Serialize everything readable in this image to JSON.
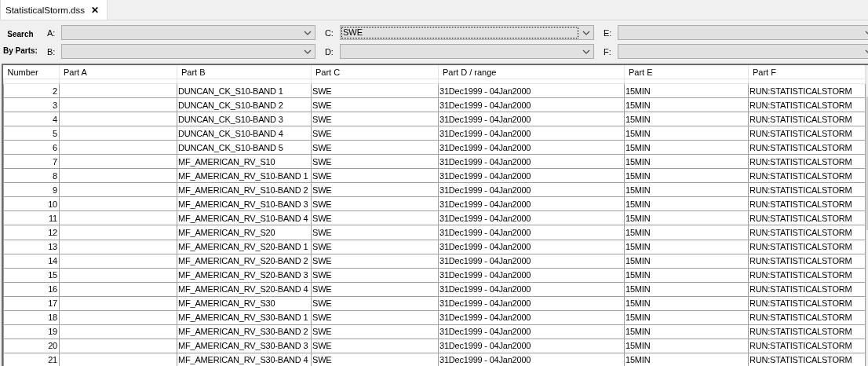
{
  "tabs": [
    {
      "label": "StatisticalStorm.dss",
      "selected": true,
      "close": "✕"
    }
  ],
  "search": {
    "title_lines": [
      "Search",
      "By Parts:"
    ],
    "fields": [
      {
        "label": "A:",
        "focused": false
      },
      {
        "label": "B:",
        "focused": false
      },
      {
        "label": "C:",
        "value": "SWE",
        "focused": true
      },
      {
        "label": "D:",
        "focused": false
      },
      {
        "label": "E:",
        "focused": false
      },
      {
        "label": "F:",
        "focused": false
      }
    ]
  },
  "table": {
    "columns": [
      "Number",
      "Part A",
      "Part B",
      "Part C",
      "Part D / range",
      "Part E",
      "Part F"
    ],
    "rows": [
      {
        "number": "2",
        "part_b": "DUNCAN_CK_S10-BAND 1",
        "part_c": "SWE",
        "part_d": "31Dec1999 - 04Jan2000",
        "part_e": "15MIN",
        "part_f": "RUN:STATISTICALSTORM"
      },
      {
        "number": "3",
        "part_b": "DUNCAN_CK_S10-BAND 2",
        "part_c": "SWE",
        "part_d": "31Dec1999 - 04Jan2000",
        "part_e": "15MIN",
        "part_f": "RUN:STATISTICALSTORM"
      },
      {
        "number": "4",
        "part_b": "DUNCAN_CK_S10-BAND 3",
        "part_c": "SWE",
        "part_d": "31Dec1999 - 04Jan2000",
        "part_e": "15MIN",
        "part_f": "RUN:STATISTICALSTORM"
      },
      {
        "number": "5",
        "part_b": "DUNCAN_CK_S10-BAND 4",
        "part_c": "SWE",
        "part_d": "31Dec1999 - 04Jan2000",
        "part_e": "15MIN",
        "part_f": "RUN:STATISTICALSTORM"
      },
      {
        "number": "6",
        "part_b": "DUNCAN_CK_S10-BAND 5",
        "part_c": "SWE",
        "part_d": "31Dec1999 - 04Jan2000",
        "part_e": "15MIN",
        "part_f": "RUN:STATISTICALSTORM"
      },
      {
        "number": "7",
        "part_b": "MF_AMERICAN_RV_S10",
        "part_c": "SWE",
        "part_d": "31Dec1999 - 04Jan2000",
        "part_e": "15MIN",
        "part_f": "RUN:STATISTICALSTORM"
      },
      {
        "number": "8",
        "part_b": "MF_AMERICAN_RV_S10-BAND 1",
        "part_c": "SWE",
        "part_d": "31Dec1999 - 04Jan2000",
        "part_e": "15MIN",
        "part_f": "RUN:STATISTICALSTORM"
      },
      {
        "number": "9",
        "part_b": "MF_AMERICAN_RV_S10-BAND 2",
        "part_c": "SWE",
        "part_d": "31Dec1999 - 04Jan2000",
        "part_e": "15MIN",
        "part_f": "RUN:STATISTICALSTORM"
      },
      {
        "number": "10",
        "part_b": "MF_AMERICAN_RV_S10-BAND 3",
        "part_c": "SWE",
        "part_d": "31Dec1999 - 04Jan2000",
        "part_e": "15MIN",
        "part_f": "RUN:STATISTICALSTORM"
      },
      {
        "number": "11",
        "part_b": "MF_AMERICAN_RV_S10-BAND 4",
        "part_c": "SWE",
        "part_d": "31Dec1999 - 04Jan2000",
        "part_e": "15MIN",
        "part_f": "RUN:STATISTICALSTORM"
      },
      {
        "number": "12",
        "part_b": "MF_AMERICAN_RV_S20",
        "part_c": "SWE",
        "part_d": "31Dec1999 - 04Jan2000",
        "part_e": "15MIN",
        "part_f": "RUN:STATISTICALSTORM"
      },
      {
        "number": "13",
        "part_b": "MF_AMERICAN_RV_S20-BAND 1",
        "part_c": "SWE",
        "part_d": "31Dec1999 - 04Jan2000",
        "part_e": "15MIN",
        "part_f": "RUN:STATISTICALSTORM"
      },
      {
        "number": "14",
        "part_b": "MF_AMERICAN_RV_S20-BAND 2",
        "part_c": "SWE",
        "part_d": "31Dec1999 - 04Jan2000",
        "part_e": "15MIN",
        "part_f": "RUN:STATISTICALSTORM"
      },
      {
        "number": "15",
        "part_b": "MF_AMERICAN_RV_S20-BAND 3",
        "part_c": "SWE",
        "part_d": "31Dec1999 - 04Jan2000",
        "part_e": "15MIN",
        "part_f": "RUN:STATISTICALSTORM"
      },
      {
        "number": "16",
        "part_b": "MF_AMERICAN_RV_S20-BAND 4",
        "part_c": "SWE",
        "part_d": "31Dec1999 - 04Jan2000",
        "part_e": "15MIN",
        "part_f": "RUN:STATISTICALSTORM"
      },
      {
        "number": "17",
        "part_b": "MF_AMERICAN_RV_S30",
        "part_c": "SWE",
        "part_d": "31Dec1999 - 04Jan2000",
        "part_e": "15MIN",
        "part_f": "RUN:STATISTICALSTORM"
      },
      {
        "number": "18",
        "part_b": "MF_AMERICAN_RV_S30-BAND 1",
        "part_c": "SWE",
        "part_d": "31Dec1999 - 04Jan2000",
        "part_e": "15MIN",
        "part_f": "RUN:STATISTICALSTORM"
      },
      {
        "number": "19",
        "part_b": "MF_AMERICAN_RV_S30-BAND 2",
        "part_c": "SWE",
        "part_d": "31Dec1999 - 04Jan2000",
        "part_e": "15MIN",
        "part_f": "RUN:STATISTICALSTORM"
      },
      {
        "number": "20",
        "part_b": "MF_AMERICAN_RV_S30-BAND 3",
        "part_c": "SWE",
        "part_d": "31Dec1999 - 04Jan2000",
        "part_e": "15MIN",
        "part_f": "RUN:STATISTICALSTORM"
      },
      {
        "number": "21",
        "part_b": "MF_AMERICAN_RV_S30-BAND 4",
        "part_c": "SWE",
        "part_d": "31Dec1999 - 04Jan2000",
        "part_e": "15MIN",
        "part_f": "RUN:STATISTICALSTORM"
      }
    ]
  }
}
